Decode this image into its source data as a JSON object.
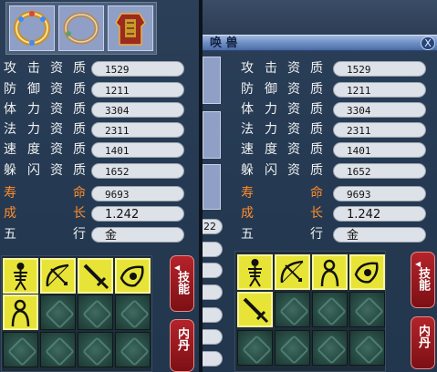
{
  "left_panel": {
    "equipment": [
      {
        "icon": "gold-ring-icon"
      },
      {
        "icon": "silver-bracelet-icon"
      },
      {
        "icon": "armor-icon"
      }
    ],
    "stats": [
      {
        "label": [
          "攻",
          "击",
          "资",
          "质"
        ],
        "value": "1529"
      },
      {
        "label": [
          "防",
          "御",
          "资",
          "质"
        ],
        "value": "1211"
      },
      {
        "label": [
          "体",
          "力",
          "资",
          "质"
        ],
        "value": "3304"
      },
      {
        "label": [
          "法",
          "力",
          "资",
          "质"
        ],
        "value": "2311"
      },
      {
        "label": [
          "速",
          "度",
          "资",
          "质"
        ],
        "value": "1401"
      },
      {
        "label": [
          "躲",
          "闪",
          "资",
          "质"
        ],
        "value": "1652"
      }
    ],
    "life": {
      "label": [
        "寿",
        "命"
      ],
      "value": "9693"
    },
    "growth": {
      "label": [
        "成",
        "长"
      ],
      "value": "1.242"
    },
    "element": {
      "label": [
        "五",
        "行"
      ],
      "value": "金"
    },
    "skills_button": "技能",
    "neidan_button": "内丹",
    "skill_icons": [
      "skeleton-icon",
      "bow-icon",
      "sword-icon",
      "eye-icon",
      "skeleton-icon",
      "shadow-figure-icon"
    ]
  },
  "right_panel": {
    "title": "唤 兽",
    "close_label": "X",
    "peek_value": "22",
    "stats": [
      {
        "label": [
          "攻",
          "击",
          "资",
          "质"
        ],
        "value": "1529"
      },
      {
        "label": [
          "防",
          "御",
          "资",
          "质"
        ],
        "value": "1211"
      },
      {
        "label": [
          "体",
          "力",
          "资",
          "质"
        ],
        "value": "3304"
      },
      {
        "label": [
          "法",
          "力",
          "资",
          "质"
        ],
        "value": "2311"
      },
      {
        "label": [
          "速",
          "度",
          "资",
          "质"
        ],
        "value": "1401"
      },
      {
        "label": [
          "躲",
          "闪",
          "资",
          "质"
        ],
        "value": "1652"
      }
    ],
    "life": {
      "label": [
        "寿",
        "命"
      ],
      "value": "9693"
    },
    "growth": {
      "label": [
        "成",
        "长"
      ],
      "value": "1.242"
    },
    "element": {
      "label": [
        "五",
        "行"
      ],
      "value": "金"
    },
    "skills_button": "技能",
    "neidan_button": "内丹",
    "skill_icons": [
      "skeleton-icon",
      "bow-icon",
      "shadow-figure-icon",
      "eye-icon",
      "sword-icon"
    ]
  },
  "colors": {
    "panel_bg": "#253a52",
    "value_pill": "#dde1e8",
    "label_white": "#f0f0f0",
    "label_orange": "#ff8c2a",
    "skill_yellow": "#e7e437",
    "button_red": "#9c1a20"
  }
}
